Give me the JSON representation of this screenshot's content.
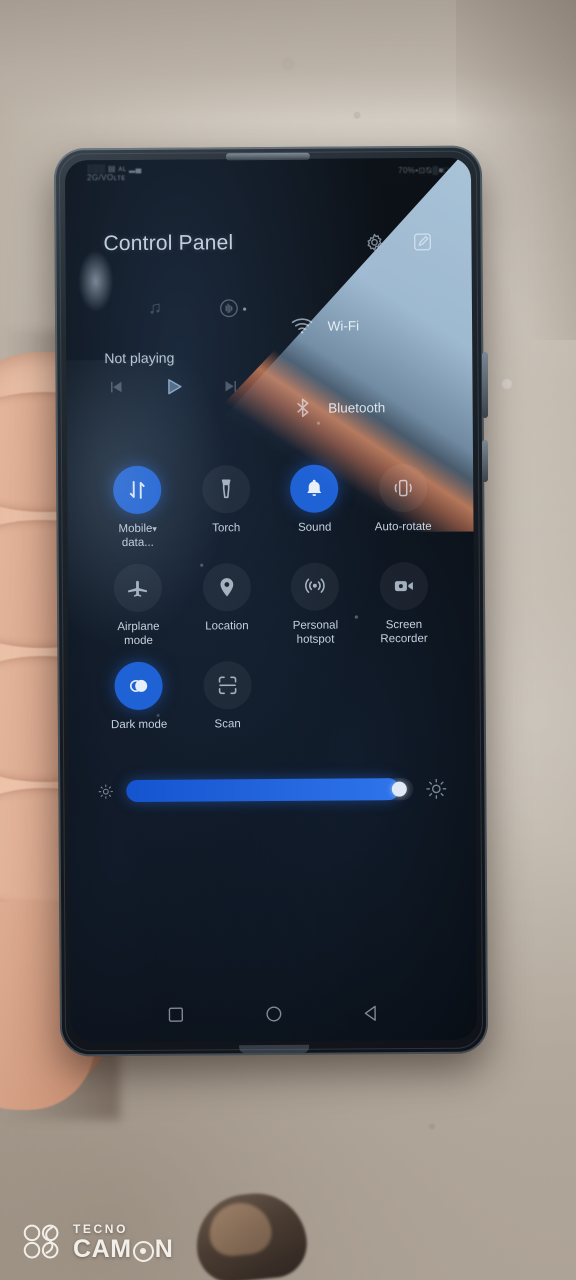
{
  "photo": {
    "watermark": {
      "brand": "TECNO",
      "model_prefix": "CAM",
      "model_suffix": "N"
    }
  },
  "statusbar": {
    "left_line1": "░░░ ▤ ᴀʟ ▂▄",
    "left_line2": "2G/VOʟᴛᴇ",
    "right": "70%▪⊡⦰▒■□"
  },
  "header": {
    "title": "Control Panel",
    "settings_icon": "gear-icon",
    "edit_icon": "edit-icon"
  },
  "media": {
    "note_icon": "music-note-icon",
    "cast_icon": "audio-output-icon",
    "status": "Not playing",
    "prev_label": "previous-track",
    "play_label": "play",
    "next_label": "next-track"
  },
  "connectivity": [
    {
      "id": "wifi",
      "label": "Wi-Fi",
      "icon": "wifi-icon"
    },
    {
      "id": "bluetooth",
      "label": "Bluetooth",
      "icon": "bluetooth-icon"
    }
  ],
  "toggles": {
    "rows": [
      [
        {
          "id": "mobile-data",
          "label": "Mobile",
          "label2": "data...",
          "caret": "▾",
          "icon": "mobile-data-icon",
          "active": true
        },
        {
          "id": "torch",
          "label": "Torch",
          "icon": "torch-icon",
          "active": false
        },
        {
          "id": "sound",
          "label": "Sound",
          "icon": "bell-icon",
          "active": true
        },
        {
          "id": "auto-rotate",
          "label": "Auto-rotate",
          "icon": "auto-rotate-icon",
          "active": false
        }
      ],
      [
        {
          "id": "airplane-mode",
          "label": "Airplane",
          "label2": "mode",
          "icon": "airplane-icon",
          "active": false
        },
        {
          "id": "location",
          "label": "Location",
          "icon": "location-pin-icon",
          "active": false
        },
        {
          "id": "personal-hotspot",
          "label": "Personal",
          "label2": "hotspot",
          "icon": "hotspot-icon",
          "active": false
        },
        {
          "id": "screen-recorder",
          "label": "Screen",
          "label2": "Recorder",
          "icon": "video-camera-icon",
          "active": false
        }
      ],
      [
        {
          "id": "dark-mode",
          "label": "Dark mode",
          "icon": "dark-mode-icon",
          "active": true
        },
        {
          "id": "scan",
          "label": "Scan",
          "icon": "scan-icon",
          "active": false
        }
      ]
    ]
  },
  "brightness": {
    "low_icon": "brightness-low-icon",
    "high_icon": "brightness-high-icon",
    "value_percent": 95
  },
  "navbar": [
    {
      "id": "recents",
      "icon": "square-recents-icon"
    },
    {
      "id": "home",
      "icon": "circle-home-icon"
    },
    {
      "id": "back",
      "icon": "triangle-back-icon"
    }
  ],
  "colors": {
    "accent_blue": "#1f62d6",
    "slider_blue": "#2f74ea",
    "text": "#c3d0de",
    "glare": "#b6d1e8",
    "glare_edge": "#e27a3a"
  }
}
